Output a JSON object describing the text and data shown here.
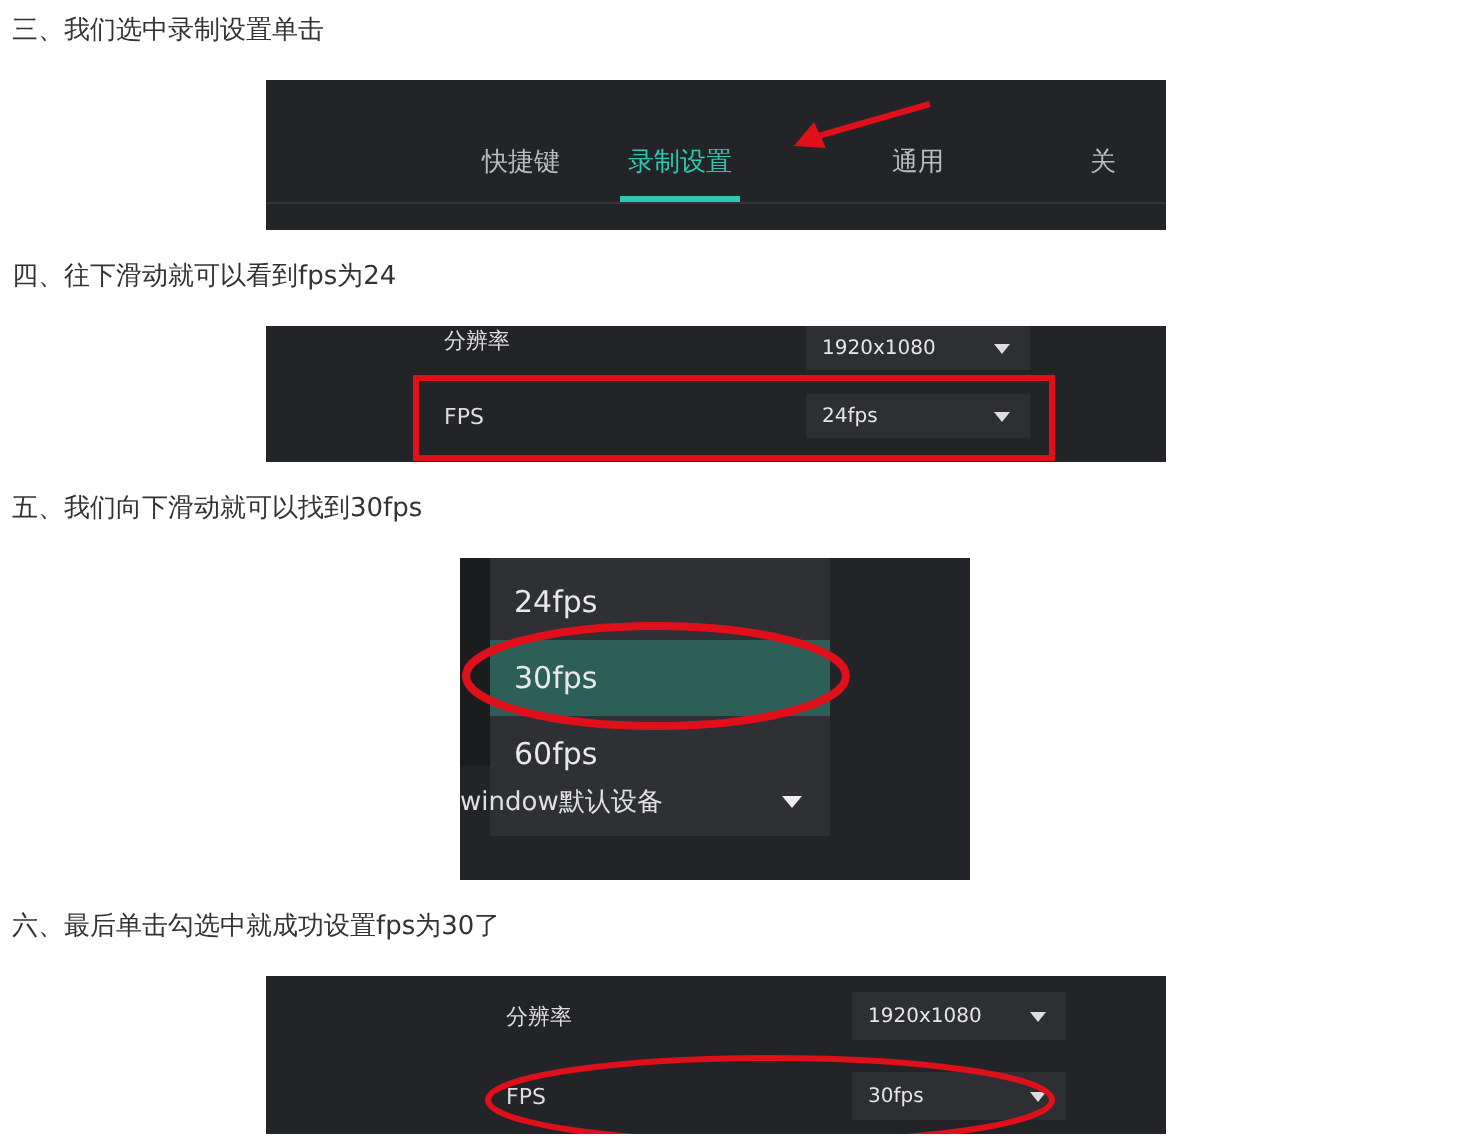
{
  "steps": [
    {
      "caption": "三、我们选中录制设置单击",
      "panel": {
        "kind": "tabs",
        "annotation": {
          "kind": "arrow"
        },
        "tabs": [
          {
            "label": "快捷键",
            "selected": false
          },
          {
            "label": "录制设置",
            "selected": true
          },
          {
            "label": "通用",
            "selected": false
          },
          {
            "label": "关",
            "selected": false
          }
        ]
      }
    },
    {
      "caption": "四、往下滑动就可以看到fps为24",
      "panel": {
        "kind": "settings",
        "annotation": {
          "kind": "box"
        },
        "rows": [
          {
            "label": "分辨率",
            "value": "1920x1080",
            "marked": false
          },
          {
            "label": "FPS",
            "value": "24fps",
            "marked": true
          }
        ]
      }
    },
    {
      "caption": "五、我们向下滑动就可以找到30fps",
      "panel": {
        "kind": "dropdown",
        "annotation": {
          "kind": "ellipse"
        },
        "select_value": "window默认设备",
        "options": [
          {
            "label": "24fps",
            "selected": false
          },
          {
            "label": "30fps",
            "selected": true
          },
          {
            "label": "60fps",
            "selected": false
          }
        ]
      }
    },
    {
      "caption": "六、最后单击勾选中就成功设置fps为30了",
      "panel": {
        "kind": "settings",
        "annotation": {
          "kind": "ellipse"
        },
        "rows": [
          {
            "label": "分辨率",
            "value": "1920x1080",
            "marked": false
          },
          {
            "label": "FPS",
            "value": "30fps",
            "marked": true
          }
        ]
      }
    }
  ]
}
